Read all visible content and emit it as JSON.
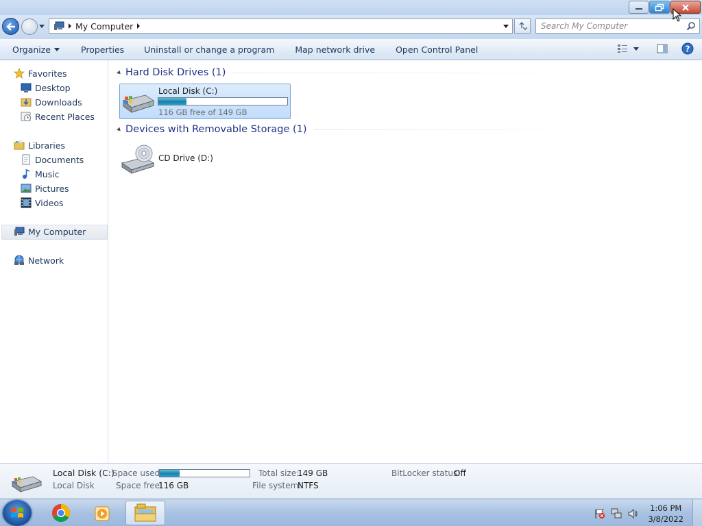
{
  "window": {
    "controls": {
      "minimize_icon": "minimize-icon",
      "restore_icon": "restore-icon",
      "close_icon": "close-icon"
    }
  },
  "address": {
    "breadcrumb": [
      "My Computer"
    ],
    "search_placeholder": "Search My Computer"
  },
  "commands": {
    "organize": "Organize",
    "properties": "Properties",
    "uninstall": "Uninstall or change a program",
    "map_drive": "Map network drive",
    "control_panel": "Open Control Panel"
  },
  "nav": {
    "favorites": "Favorites",
    "desktop": "Desktop",
    "downloads": "Downloads",
    "recent": "Recent Places",
    "libraries": "Libraries",
    "documents": "Documents",
    "music": "Music",
    "pictures": "Pictures",
    "videos": "Videos",
    "computer": "My Computer",
    "network": "Network"
  },
  "groups": {
    "hdd": "Hard Disk Drives (1)",
    "removable": "Devices with Removable Storage (1)"
  },
  "drives": {
    "c": {
      "name": "Local Disk (C:)",
      "free_text": "116 GB free of 149 GB",
      "used_fraction": 0.22
    },
    "d": {
      "name": "CD Drive (D:)"
    }
  },
  "details": {
    "name": "Local Disk (C:)",
    "type": "Local Disk",
    "space_used_label": "Space used:",
    "space_free_label": "Space free:",
    "space_free": "116 GB",
    "total_size_label": "Total size:",
    "total_size": "149 GB",
    "file_system_label": "File system:",
    "file_system": "NTFS",
    "bitlocker_label": "BitLocker status:",
    "bitlocker": "Off",
    "used_fraction": 0.22
  },
  "taskbar": {
    "time": "1:06 PM",
    "date": "3/8/2022"
  },
  "colors": {
    "accent": "#1e3287",
    "selection": "#c1dcfc",
    "bar_fill": "#1b7fa8"
  }
}
